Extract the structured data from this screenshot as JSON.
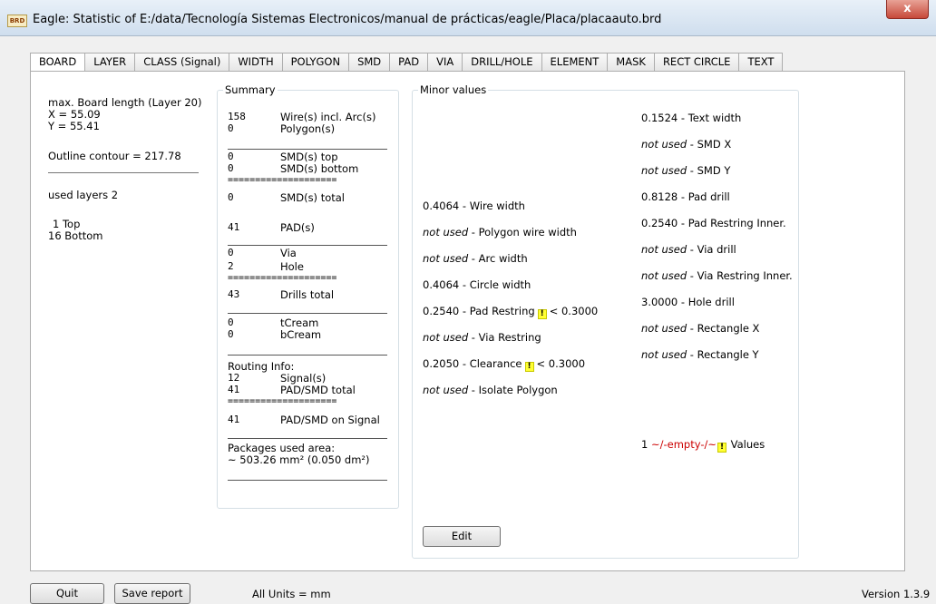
{
  "window": {
    "icon_text": "BRD",
    "title": "Eagle: Statistic of E:/data/Tecnología Sistemas Electronicos/manual de prácticas/eagle/Placa/placaauto.brd",
    "close_label": "x"
  },
  "tabs": [
    "BOARD",
    "LAYER",
    "CLASS (Signal)",
    "WIDTH",
    "POLYGON",
    "SMD",
    "PAD",
    "VIA",
    "DRILL/HOLE",
    "ELEMENT",
    "MASK",
    "RECT CIRCLE",
    "TEXT"
  ],
  "left": {
    "board_length": "max. Board length (Layer 20)",
    "x": "X = 55.09",
    "y": "Y = 55.41",
    "outline": "Outline contour = 217.78",
    "used_layers": "used layers 2",
    "layer1": "1 Top",
    "layer2": "16 Bottom"
  },
  "summary": {
    "title": "Summary",
    "wire_count": "158",
    "wire_label": "Wire(s) incl. Arc(s)",
    "poly_count": "0",
    "poly_label": "Polygon(s)",
    "smd_top_count": "0",
    "smd_top_label": "SMD(s) top",
    "smd_bottom_count": "0",
    "smd_bottom_label": "SMD(s) bottom",
    "sep": "====================",
    "smd_total_count": "0",
    "smd_total_label": "SMD(s) total",
    "pad_count": "41",
    "pad_label": "PAD(s)",
    "via_count": "0",
    "via_label": "Via",
    "hole_count": "2",
    "hole_label": "Hole",
    "drills_count": "43",
    "drills_label": "Drills total",
    "tcream_count": "0",
    "tcream_label": "tCream",
    "bcream_count": "0",
    "bcream_label": "bCream",
    "routing": "Routing Info:",
    "signal_count": "12",
    "signal_label": "Signal(s)",
    "padsmd_count": "41",
    "padsmd_label": "PAD/SMD total",
    "padsmd_sig_count": "41",
    "padsmd_sig_label": "PAD/SMD on Signal",
    "packages": "Packages used area:",
    "area": "~ 503.26 mm² (0.050 dm²)"
  },
  "minor": {
    "title": "Minor values",
    "not_used": "not used",
    "warn_mark": "!",
    "wire_width": "0.4064 - Wire width",
    "poly_wire": " - Polygon wire width",
    "arc_width": " - Arc width",
    "circle_width": "0.4064 - Circle width",
    "pad_restring": "0.2540 - Pad Restring",
    "pad_restring_limit": "< 0.3000",
    "via_restring": " - Via Restring",
    "clearance": "0.2050 - Clearance",
    "clearance_limit": "< 0.3000",
    "isolate": " - Isolate Polygon",
    "text_width": "0.1524 - Text width",
    "smd_x": " - SMD X",
    "smd_y": " - SMD Y",
    "pad_drill": "0.8128 - Pad drill",
    "pad_restring_inner": "0.2540 - Pad Restring Inner.",
    "via_drill": " - Via drill",
    "via_restring_inner": " - Via Restring Inner.",
    "hole_drill": "3.0000 - Hole drill",
    "rect_x": " - Rectangle X",
    "rect_y": " - Rectangle Y",
    "empty_count": "1 ",
    "empty_text": "~/-empty-/~",
    "values_text": " Values",
    "edit_label": "Edit"
  },
  "bottom": {
    "quit_label": "Quit",
    "save_label": "Save report",
    "units": "All Units = mm",
    "version": "Version 1.3.9"
  }
}
